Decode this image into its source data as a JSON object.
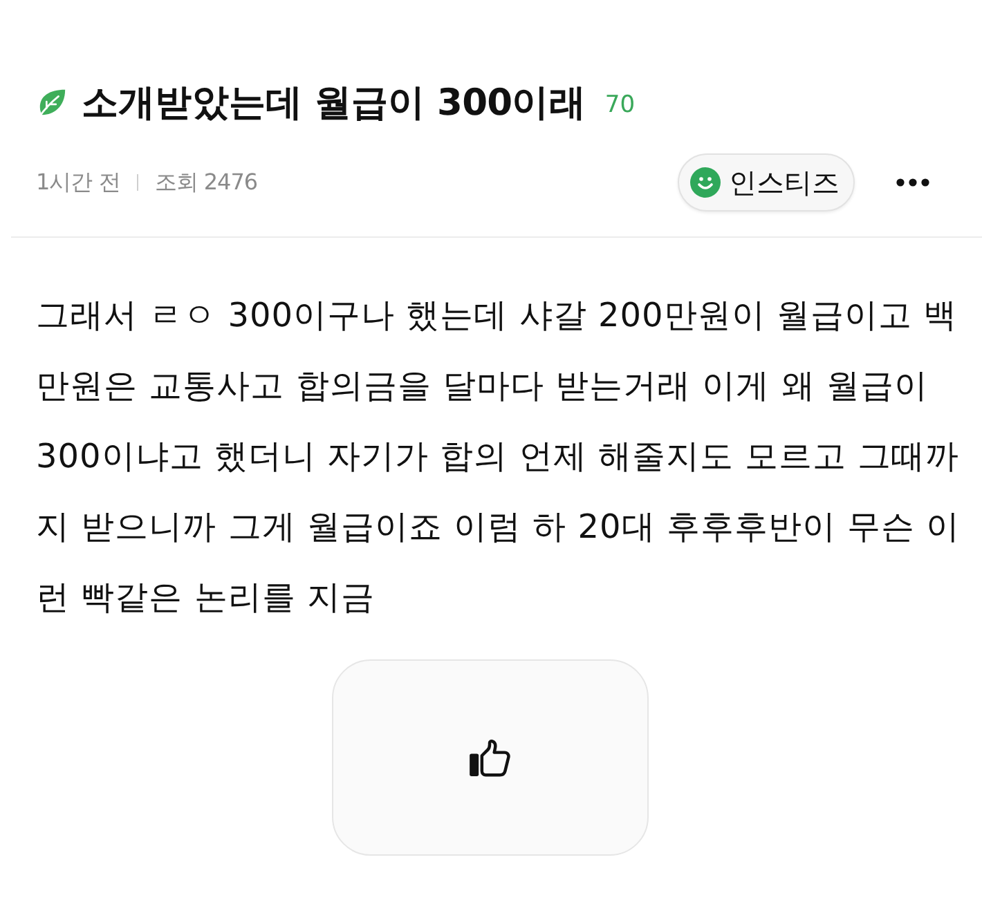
{
  "post": {
    "title": "소개받았는데 월급이 300이래",
    "comment_count": "70",
    "time": "1시간 전",
    "views": "조회 2476",
    "category": "인스티즈"
  },
  "body": "그래서 ㄹㅇ 300이구나 했는데 샤갈 200만원이 월급이고 백만원은 교통사고 합의금을 달마다 받는거래 이게 왜 월급이 300이냐고 했더니 자기가 합의 언제 해줄지도 모르고 그때까지 받으니까 그게 월급이죠 이럼 하 20대 후후후반이 무슨 이런 빡같은 논리를 지금"
}
